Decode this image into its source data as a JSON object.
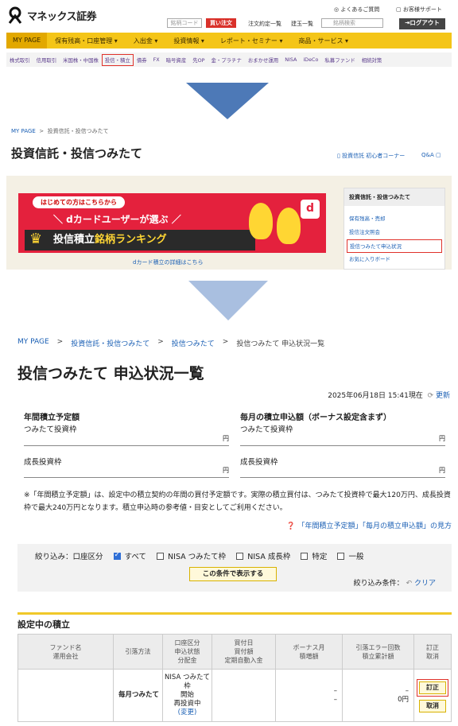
{
  "panel1": {
    "logo": "マネックス証券",
    "faq": "よくあるご質問",
    "support": "お客様サポート",
    "brand_code": "銘柄コード",
    "buy_order": "買い注文",
    "schedule": "注文約定一覧",
    "balance": "建玉一覧",
    "search_placeholder": "銘柄検索",
    "logout": "ログアウト",
    "nav": [
      "MY PAGE",
      "保有残高・口座管理 ▾",
      "入出金 ▾",
      "投資情報 ▾",
      "レポート・セミナー ▾",
      "商品・サービス ▾"
    ],
    "subnav": [
      "株式取引",
      "信用取引",
      "米国株・中国株",
      "投信・積立",
      "債券",
      "FX",
      "暗号資産",
      "先OP",
      "金・プラチナ",
      "おまかせ運用",
      "NISA",
      "iDeCo",
      "私募ファンド",
      "相続対策"
    ],
    "subnav_selected": "投信・積立"
  },
  "panel2": {
    "breadcrumb": [
      "MY PAGE",
      ">",
      "投資信託・投信つみたて"
    ],
    "title": "投資信託・投信つみたて",
    "link_beginner": "投資信託 初心者コーナー",
    "link_qa": "Q&A",
    "banner_top": "はじめての方はこちらから",
    "banner_mid": "＼ dカードユーザーが選ぶ ／",
    "banner_bot_a": "投信積立",
    "banner_bot_b": "銘柄ランキング",
    "banner_dpoint": "d",
    "banner_caption": "dカード積立の詳細はこちら",
    "side_title": "投資信託・投信つみたて",
    "side_items": [
      "保有残高・売却",
      "投信注文照会",
      "投信つみたて申込状況",
      "お気に入りボード"
    ],
    "side_selected": "投信つみたて申込状況"
  },
  "panel3": {
    "breadcrumb": [
      "MY PAGE",
      ">",
      "投資信託・投信つみたて",
      ">",
      "投信つみたて",
      ">",
      "投信つみたて 申込状況一覧"
    ],
    "title": "投信つみたて 申込状況一覧",
    "datetime": "2025年06月18日 15:41現在",
    "refresh": "更新",
    "annual_title": "年間積立予定額",
    "monthly_title": "毎月の積立申込額（ボーナス設定含まず）",
    "tsumitate": "つみたて投資枠",
    "growth": "成長投資枠",
    "yen": "円",
    "note": "※「年間積立予定額」は、設定中の積立契約の年間の買付予定額です。実際の積立買付は、つみたて投資枠で最大120万円、成長投資枠で最大240万円となります。積立申込時の参考値・目安としてご利用ください。",
    "help": "「年間積立予定額」「毎月の積立申込額」の見方",
    "filter_label": "絞り込み：口座区分",
    "filter_opts": [
      "すべて",
      "NISA つみたて枠",
      "NISA 成長枠",
      "特定",
      "一般"
    ],
    "filter_btn": "この条件で表示する",
    "filter_cond": "絞り込み条件：",
    "clear": "クリア",
    "section": "設定中の積立",
    "headers": [
      "ファンド名\n運用会社",
      "引落方法",
      "口座区分\n申込状態\n分配金",
      "買付日\n買付額\n定期自動入金",
      "ボーナス月\n積増額",
      "引落エラー回数\n積立累計額",
      "訂正\n取消"
    ],
    "row": {
      "method": "毎月つみたて",
      "account": "NISA つみたて枠",
      "state": "開始",
      "dist": "再投資中",
      "change": "(変更)",
      "bonus_a": "–",
      "bonus_b": "–",
      "err": "–",
      "total": "0円",
      "edit": "訂正",
      "cancel": "取消"
    }
  },
  "colors": {
    "nav": "#f4c518",
    "accent_red": "#e0322b",
    "arrow": "#4d79b7",
    "link": "#1a5fb4"
  }
}
